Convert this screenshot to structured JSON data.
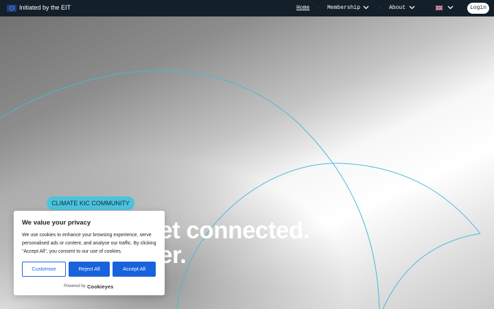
{
  "topbar": {
    "eit_label": "Initiated by the EIT",
    "nav": {
      "home": "Home",
      "membership": "Membership",
      "about": "About",
      "separator": "·"
    },
    "login": "Login"
  },
  "hero": {
    "badge": "CLIMATE KIC COMMUNITY",
    "headline_line1": "et connected.",
    "headline_line2": "er."
  },
  "cookie_banner": {
    "title": "We value your privacy",
    "body": "We use cookies to enhance your browsing experience, serve personalised ads or content, and analyse our traffic. By clicking \"Accept All\", you consent to our use of cookies.",
    "customise": "Customise",
    "reject_all": "Reject All",
    "accept_all": "Accept All",
    "powered_by": "Powered by",
    "brand": "Cookieyes"
  },
  "colors": {
    "topbar": "#142029",
    "accent_cyan": "#4ec3dd",
    "button_blue": "#1863dc"
  }
}
